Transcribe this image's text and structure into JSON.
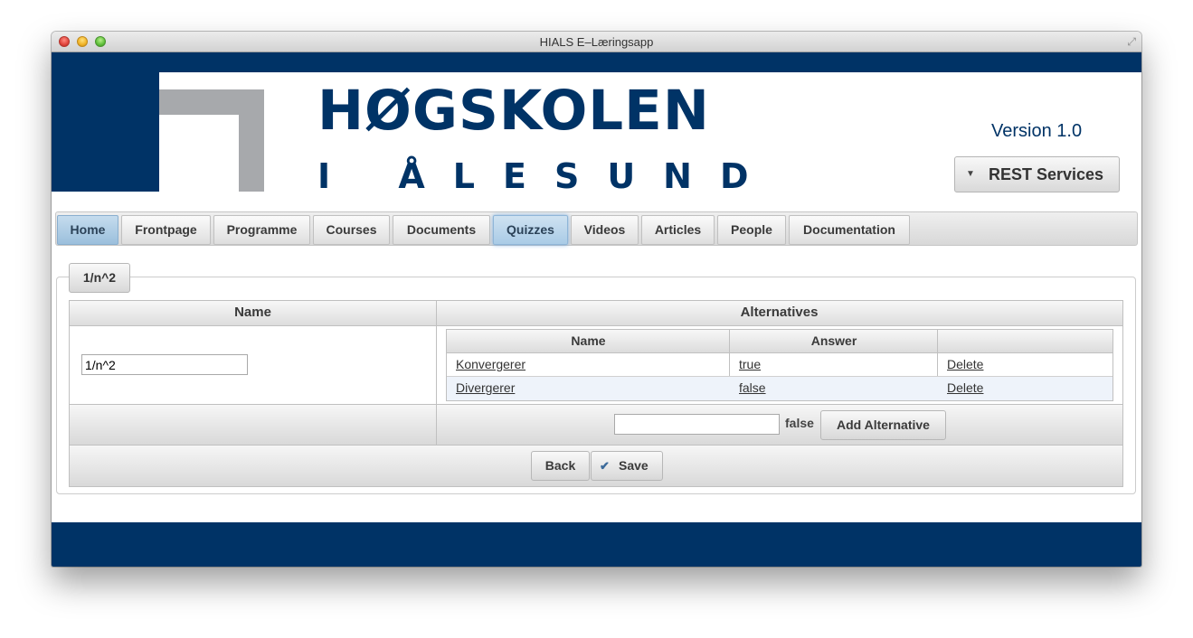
{
  "window": {
    "title": "HIALS E–Læringsapp",
    "fullscreen_icon": "fullscreen-arrows-icon"
  },
  "header": {
    "logo_line1": "HØGSKOLEN",
    "logo_line2": "I ÅLESUND",
    "version": "Version 1.0",
    "rest_button": "REST Services",
    "rest_icon": "dropdown-triangle-icon"
  },
  "tabs": [
    "Home",
    "Frontpage",
    "Programme",
    "Courses",
    "Documents",
    "Quizzes",
    "Videos",
    "Articles",
    "People",
    "Documentation"
  ],
  "active_tab": "Home",
  "highlighted_tab": "Quizzes",
  "quiz": {
    "legend": "1/n^2",
    "name_header": "Name",
    "alternatives_header": "Alternatives",
    "name_value": "1/n^2",
    "alt_columns": [
      "Name",
      "Answer",
      ""
    ],
    "alternatives": [
      {
        "name": "Konvergerer",
        "answer": "true",
        "action": "Delete"
      },
      {
        "name": "Divergerer",
        "answer": "false",
        "action": "Delete"
      }
    ],
    "new_alt_value": "",
    "new_alt_answer": "false",
    "add_button": "Add Alternative",
    "back_button": "Back",
    "save_button": "Save",
    "save_icon": "checkmark-icon"
  },
  "colors": {
    "brand_navy": "#003366",
    "logo_gray": "#a7a9ac",
    "tab_active": "#9bbfdc"
  }
}
